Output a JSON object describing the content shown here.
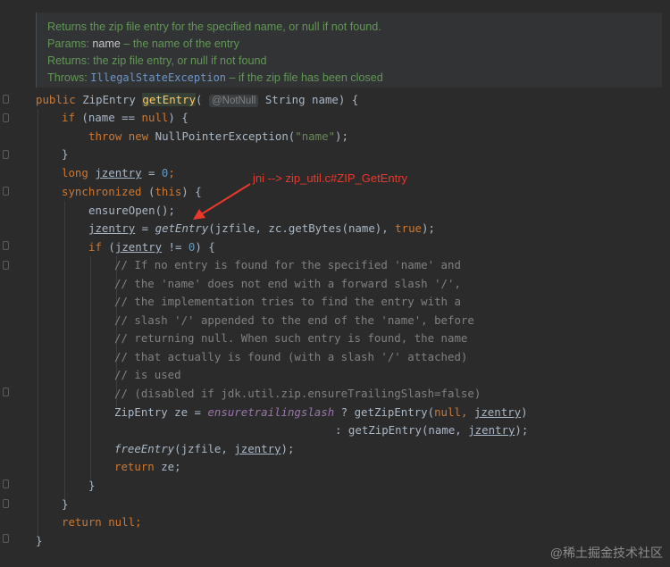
{
  "doc": {
    "line1": "Returns the zip file entry for the specified name, or null if not found.",
    "params_label": "Params: ",
    "params_name": "name",
    "params_desc": " – the name of the entry",
    "returns": "Returns: the zip file entry, or null if not found",
    "throws_label": "Throws: ",
    "throws_exception": "IllegalStateException",
    "throws_desc": " – if the zip file has been closed"
  },
  "code": {
    "l1_public": "public ",
    "l1_type": "ZipEntry ",
    "l1_method": "getEntry",
    "l1_paren": "( ",
    "l1_anno": "@NotNull",
    "l1_rest": " String name) {",
    "l2_if": "if ",
    "l2_cond": "(name == ",
    "l2_null": "null",
    "l2_end": ") {",
    "l3_throw": "throw new ",
    "l3_exc": "NullPointerException(",
    "l3_str": "\"name\"",
    "l3_end": ");",
    "l4": "}",
    "l5_long": "long ",
    "l5_var": "jzentry",
    "l5_eq": " = ",
    "l5_num": "0",
    "l5_end": ";",
    "l6_sync": "synchronized ",
    "l6_this_open": "(",
    "l6_this": "this",
    "l6_end": ") {",
    "l7": "ensureOpen();",
    "l8_var": "jzentry",
    "l8_eq": " = ",
    "l8_call": "getEntry",
    "l8_args1": "(jzfile, zc.getBytes(name), ",
    "l8_true": "true",
    "l8_end": ");",
    "l9_if": "if ",
    "l9_open": "(",
    "l9_var": "jzentry",
    "l9_ne": " != ",
    "l9_num": "0",
    "l9_end": ") {",
    "c1": "// If no entry is found for the specified 'name' and",
    "c2": "// the 'name' does not end with a forward slash '/',",
    "c3": "// the implementation tries to find the entry with a",
    "c4": "// slash '/' appended to the end of the 'name', before",
    "c5": "// returning null. When such entry is found, the name",
    "c6": "// that actually is found (with a slash '/' attached)",
    "c7": "// is used",
    "c8": "// (disabled if jdk.util.zip.ensureTrailingSlash=false)",
    "l18_decl": "ZipEntry ze = ",
    "l18_field": "ensuretrailingslash",
    "l18_q": " ? getZipEntry(",
    "l18_null": "null",
    "l18_comma": ", ",
    "l18_var": "jzentry",
    "l18_end": ")",
    "l19_colon": ": getZipEntry(name, ",
    "l19_var": "jzentry",
    "l19_end": ");",
    "l20_call": "freeEntry",
    "l20_args": "(jzfile, ",
    "l20_var": "jzentry",
    "l20_end": ");",
    "l21_ret": "return ",
    "l21_val": "ze;",
    "l22": "}",
    "l23": "}",
    "l24_ret": "return ",
    "l24_null": "null",
    "l24_end": ";",
    "l25": "}"
  },
  "annotation": "jni --> zip_util.c#ZIP_GetEntry",
  "watermark": "@稀土掘金技术社区",
  "colors": {
    "background": "#2b2b2b",
    "keyword": "#cc7832",
    "string": "#6a8759",
    "number": "#6897bb",
    "comment": "#808080",
    "method": "#ffc66d",
    "doc": "#629755",
    "annotation_red": "#e8392c"
  }
}
